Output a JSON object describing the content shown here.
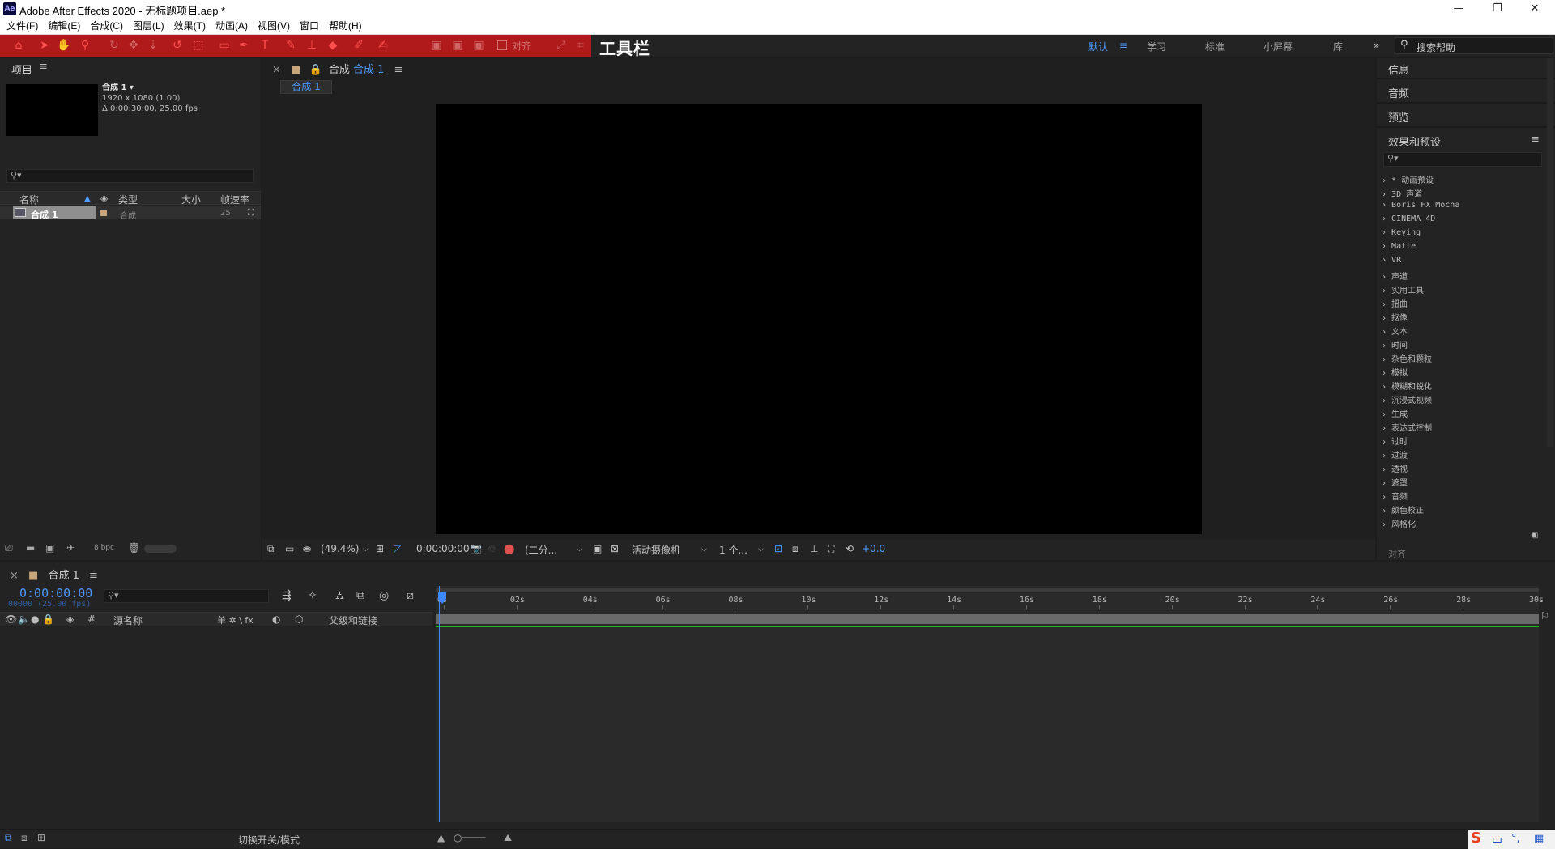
{
  "window": {
    "title": "Adobe After Effects 2020 - 无标题项目.aep *",
    "app_icon": "Ae",
    "controls": [
      "—",
      "❐",
      "✕"
    ]
  },
  "menu": [
    "文件(F)",
    "编辑(E)",
    "合成(C)",
    "图层(L)",
    "效果(T)",
    "动画(A)",
    "视图(V)",
    "窗口",
    "帮助(H)"
  ],
  "toolbar": {
    "align_label": "对齐",
    "label": "工具栏",
    "workspaces": [
      "默认",
      "学习",
      "标准",
      "小屏幕",
      "库"
    ],
    "overflow": "»",
    "help_placeholder": "搜索帮助",
    "accent_color": "#b01a1a"
  },
  "project": {
    "tab": "项目",
    "comp_name": "合成 1 ▾",
    "comp_res": "1920 x 1080 (1.00)",
    "comp_dur": "Δ 0:00:30:00, 25.00 fps",
    "columns": [
      "名称",
      "类型",
      "大小",
      "帧速率"
    ],
    "item": {
      "name": "合成 1",
      "type": "合成",
      "fps": "25"
    },
    "bpc": "8 bpc"
  },
  "viewer": {
    "tab_prefix": "合成",
    "tab_name": "合成 1",
    "subtab": "合成 1",
    "zoom": "(49.4%)",
    "timecode": "0:00:00:00",
    "resolution": "(二分...",
    "camera": "活动摄像机",
    "views": "1 个...",
    "exposure": "+0.0"
  },
  "right": {
    "info": "信息",
    "audio": "音频",
    "preview": "预览",
    "effects": "效果和预设",
    "align": "对齐",
    "effect_categories": [
      "* 动画预设",
      "3D 声道",
      "Boris FX Mocha",
      "CINEMA 4D",
      "Keying",
      "Matte",
      "VR",
      "声道",
      "实用工具",
      "扭曲",
      "抠像",
      "文本",
      "时间",
      "杂色和颗粒",
      "模拟",
      "模糊和锐化",
      "沉浸式视频",
      "生成",
      "表达式控制",
      "过时",
      "过渡",
      "透视",
      "遮罩",
      "音频",
      "颜色校正",
      "风格化"
    ]
  },
  "timeline": {
    "tab": "合成 1",
    "timecode": "0:00:00:00",
    "frames": "00000 (25.00 fps)",
    "columns": {
      "source": "源名称",
      "parent": "父级和链接",
      "switches": "单 ✲ \\ fx"
    },
    "ruler": [
      "0s",
      "02s",
      "04s",
      "06s",
      "08s",
      "10s",
      "12s",
      "14s",
      "16s",
      "18s",
      "20s",
      "22s",
      "24s",
      "26s",
      "28s",
      "30s"
    ],
    "switch_modes": "切换开关/模式",
    "work_area_color": "#19c019",
    "playhead_color": "#3c88ff"
  },
  "ime": {
    "logo": "S",
    "lang": "中",
    "punct": "°,"
  }
}
